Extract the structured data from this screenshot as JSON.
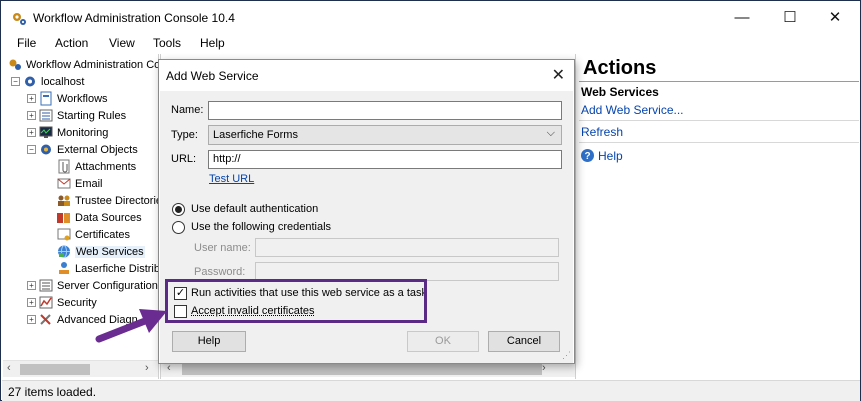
{
  "window": {
    "title": "Workflow Administration Console 10.4",
    "minimize": "—",
    "maximize": "☐",
    "close": "✕"
  },
  "menu": [
    "File",
    "Action",
    "View",
    "Tools",
    "Help"
  ],
  "tree": {
    "root": "Workflow Administration Co",
    "server": "localhost",
    "items": [
      {
        "label": "Workflows",
        "expander": "+",
        "level": 2
      },
      {
        "label": "Starting Rules",
        "expander": "+",
        "level": 2
      },
      {
        "label": "Monitoring",
        "expander": "+",
        "level": 2
      },
      {
        "label": "External Objects",
        "expander": "−",
        "level": 2
      },
      {
        "label": "Attachments",
        "expander": "",
        "level": 3
      },
      {
        "label": "Email",
        "expander": "",
        "level": 3
      },
      {
        "label": "Trustee Directorie",
        "expander": "",
        "level": 3
      },
      {
        "label": "Data Sources",
        "expander": "",
        "level": 3
      },
      {
        "label": "Certificates",
        "expander": "",
        "level": 3
      },
      {
        "label": "Web Services",
        "expander": "",
        "level": 3
      },
      {
        "label": "Laserfiche Distrib",
        "expander": "",
        "level": 3
      },
      {
        "label": "Server Configuration",
        "expander": "+",
        "level": 2
      },
      {
        "label": "Security",
        "expander": "+",
        "level": 2
      },
      {
        "label": "Advanced Diagn",
        "expander": "+",
        "level": 2
      }
    ]
  },
  "actions": {
    "title": "Actions",
    "section": "Web Services",
    "links": [
      "Add Web Service...",
      "Refresh",
      "Help"
    ]
  },
  "status": "27 items loaded.",
  "dialog": {
    "title": "Add Web Service",
    "name_label": "Name:",
    "name_value": "",
    "type_label": "Type:",
    "type_value": "Laserfiche Forms",
    "url_label": "URL:",
    "url_value": "http://",
    "test_url": "Test URL",
    "auth_default": "Use default authentication",
    "auth_credentials": "Use the following credentials",
    "username_label": "User name:",
    "password_label": "Password:",
    "run_as_task": "Run activities that use this web service as a task",
    "accept_invalid": "Accept invalid certificates",
    "help_button": "Help",
    "ok_button": "OK",
    "cancel_button": "Cancel"
  },
  "colors": {
    "highlight": "#5b2a86",
    "arrow": "#6a2c91",
    "link": "#0645ad"
  }
}
